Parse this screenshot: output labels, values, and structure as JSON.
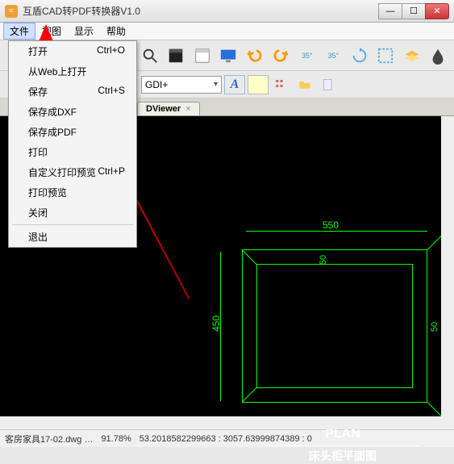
{
  "title": "互盾CAD转PDF转换器V1.0",
  "menubar": [
    "文件",
    "视图",
    "显示",
    "帮助"
  ],
  "dropdown": [
    {
      "label": "打开",
      "shortcut": "Ctrl+O"
    },
    {
      "label": "从Web上打开",
      "shortcut": ""
    },
    {
      "label": "保存",
      "shortcut": "Ctrl+S"
    },
    {
      "label": "保存成DXF",
      "shortcut": ""
    },
    {
      "label": "保存成PDF",
      "shortcut": ""
    },
    {
      "label": "打印",
      "shortcut": ""
    },
    {
      "label": "自定义打印预览",
      "shortcut": "Ctrl+P"
    },
    {
      "label": "打印预览",
      "shortcut": ""
    },
    {
      "label": "关闭",
      "shortcut": ""
    },
    {
      "sep": true
    },
    {
      "label": "退出",
      "shortcut": ""
    }
  ],
  "toolbar2": {
    "angle1": "35°",
    "angle2": "35°"
  },
  "gdi_select": "GDI+",
  "tab": {
    "label": "DViewer"
  },
  "drawing": {
    "dim_top": "550",
    "dim_inner_top": "50",
    "dim_left": "450",
    "dim_right": "50",
    "plan_label": "PLAN",
    "plan_sub": "床头柜平面图"
  },
  "statusbar": {
    "file": "客房家具17-02.dwg …",
    "zoom": "91.78%",
    "coords": "53.2018582299663 : 3057.63999874389 : 0"
  }
}
